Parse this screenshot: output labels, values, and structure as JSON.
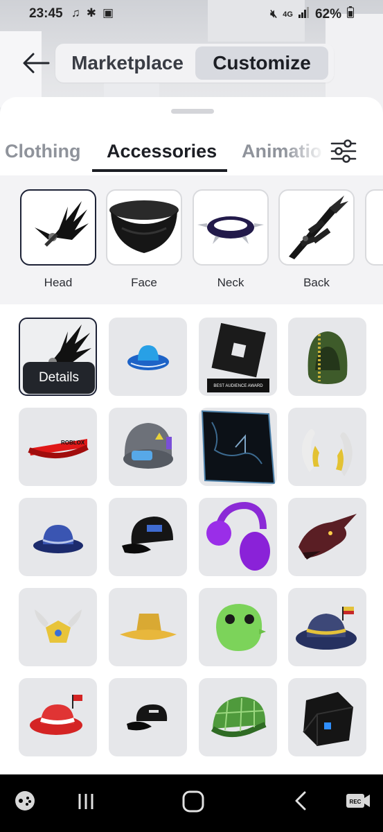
{
  "status_bar": {
    "time": "23:45",
    "network": "4G",
    "battery": "62%"
  },
  "header": {
    "segments": [
      {
        "label": "Marketplace",
        "selected": false
      },
      {
        "label": "Customize",
        "selected": true
      }
    ]
  },
  "tabs": [
    {
      "label": "Clothing",
      "selected": false
    },
    {
      "label": "Accessories",
      "selected": true
    },
    {
      "label": "Animatio",
      "selected": false
    }
  ],
  "subcategories": [
    {
      "label": "Head",
      "icon": "wings-head-icon",
      "selected": true
    },
    {
      "label": "Face",
      "icon": "scarf-icon",
      "selected": false
    },
    {
      "label": "Neck",
      "icon": "spiked-collar-icon",
      "selected": false
    },
    {
      "label": "Back",
      "icon": "sword-icon",
      "selected": false
    }
  ],
  "items": [
    {
      "icon": "black-wings-icon",
      "selected": true
    },
    {
      "icon": "blue-cowboy-hat-icon"
    },
    {
      "icon": "roblox-award-icon",
      "award_text": "BEST AUDIENCE AWARD"
    },
    {
      "icon": "green-hood-icon"
    },
    {
      "icon": "red-visor-icon",
      "visor_text": "ROBLOX"
    },
    {
      "icon": "hard-hat-icon"
    },
    {
      "icon": "dark-cube-icon"
    },
    {
      "icon": "horns-icon"
    },
    {
      "icon": "blue-fedora-icon"
    },
    {
      "icon": "black-cap-icon"
    },
    {
      "icon": "purple-earmuffs-icon"
    },
    {
      "icon": "dragon-head-icon"
    },
    {
      "icon": "winged-crown-icon"
    },
    {
      "icon": "yellow-bucket-hat-icon"
    },
    {
      "icon": "green-blob-icon"
    },
    {
      "icon": "navy-fedora-icon"
    },
    {
      "icon": "red-cap-icon"
    },
    {
      "icon": "roblox-cap-icon"
    },
    {
      "icon": "plaid-cap-icon"
    },
    {
      "icon": "glowing-cube-icon"
    }
  ],
  "details_label": "Details",
  "colors": {
    "accent": "#1d2236",
    "cell_bg": "#e6e7ea",
    "navbar": "#000000"
  }
}
